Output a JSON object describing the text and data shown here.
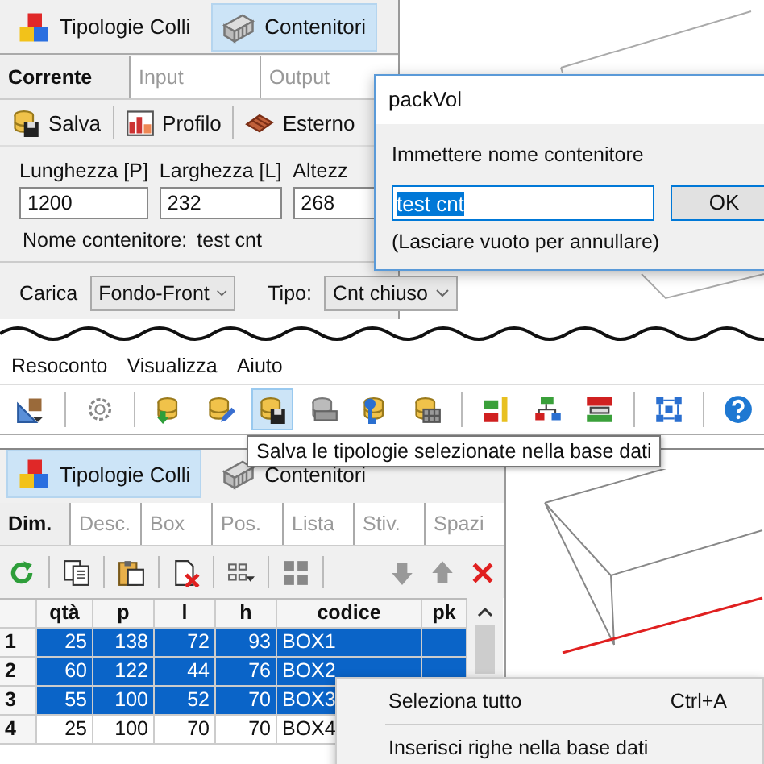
{
  "top_panel": {
    "tabs": [
      {
        "label": "Tipologie Colli",
        "kind": "cubes",
        "selected": false
      },
      {
        "label": "Contenitori",
        "kind": "container",
        "selected": true
      }
    ],
    "sub_tabs": [
      {
        "label": "Corrente",
        "selected": true
      },
      {
        "label": "Input",
        "selected": false
      },
      {
        "label": "Output",
        "selected": false
      }
    ],
    "toolbar": [
      {
        "label": "Salva",
        "kind": "db-save"
      },
      {
        "label": "Profilo",
        "kind": "chart"
      },
      {
        "label": "Esterno",
        "kind": "pallet"
      }
    ],
    "fields": [
      {
        "label": "Lunghezza [P]",
        "value": "1200"
      },
      {
        "label": "Larghezza [L]",
        "value": "232"
      },
      {
        "label": "Altezz",
        "value": "268"
      }
    ],
    "name_label": "Nome contenitore:",
    "name_value": "test cnt",
    "load_label": "Carica",
    "load_value": "Fondo-Front",
    "type_label": "Tipo:",
    "type_value": "Cnt chiuso"
  },
  "dialog": {
    "title": "packVol",
    "prompt": "Immettere nome contenitore",
    "value": "test cnt",
    "value_selected": true,
    "ok": "OK",
    "hint": "(Lasciare vuoto per annullare)"
  },
  "menu": [
    "Resoconto",
    "Visualizza",
    "Aiuto"
  ],
  "toolbar": [
    [
      {
        "kind": "measure",
        "hovered": false
      }
    ],
    [
      {
        "kind": "gear",
        "hovered": false
      }
    ],
    [
      {
        "kind": "db-down",
        "hovered": false
      },
      {
        "kind": "db-edit",
        "hovered": false
      },
      {
        "kind": "db-save",
        "hovered": true
      },
      {
        "kind": "db-block",
        "hovered": false
      },
      {
        "kind": "db-key",
        "hovered": false
      },
      {
        "kind": "db-grid",
        "hovered": false
      }
    ],
    [
      {
        "kind": "bars-a",
        "hovered": false
      },
      {
        "kind": "tree",
        "hovered": false
      },
      {
        "kind": "bars-b",
        "hovered": false
      }
    ],
    [
      {
        "kind": "network",
        "hovered": false
      }
    ],
    [
      {
        "kind": "help",
        "hovered": false
      }
    ]
  ],
  "tooltip": "Salva le tipologie selezionate nella base dati",
  "bottom_panel": {
    "tabs": [
      {
        "label": "Tipologie Colli",
        "kind": "cubes",
        "selected": true
      },
      {
        "label": "Contenitori",
        "kind": "container",
        "selected": false
      }
    ],
    "sub_tabs": [
      {
        "label": "Dim.",
        "selected": true
      },
      {
        "label": "Desc.",
        "selected": false
      },
      {
        "label": "Box",
        "selected": false
      },
      {
        "label": "Pos.",
        "selected": false
      },
      {
        "label": "Lista",
        "selected": false
      },
      {
        "label": "Stiv.",
        "selected": false
      },
      {
        "label": "Spazi",
        "selected": false
      }
    ],
    "toolbar": [
      [
        {
          "kind": "refresh"
        }
      ],
      [
        {
          "kind": "copy"
        }
      ],
      [
        {
          "kind": "paste"
        }
      ],
      [
        {
          "kind": "delete"
        }
      ],
      [
        {
          "kind": "grid-menu"
        }
      ],
      [
        {
          "kind": "grid"
        }
      ],
      [
        {
          "kind": "down"
        },
        {
          "kind": "up"
        },
        {
          "kind": "close"
        }
      ]
    ],
    "table": {
      "columns": [
        "qtà",
        "p",
        "l",
        "h",
        "codice",
        "pk"
      ],
      "rows": [
        {
          "number": "1",
          "cells": [
            "25",
            "138",
            "72",
            "93",
            "BOX1"
          ],
          "selected": true
        },
        {
          "number": "2",
          "cells": [
            "60",
            "122",
            "44",
            "76",
            "BOX2"
          ],
          "selected": true
        },
        {
          "number": "3",
          "cells": [
            "55",
            "100",
            "52",
            "70",
            "BOX3"
          ],
          "selected": true
        },
        {
          "number": "4",
          "cells": [
            "25",
            "100",
            "70",
            "70",
            "BOX4"
          ],
          "selected": false
        }
      ]
    }
  },
  "context_menu": [
    {
      "label": "Seleziona tutto",
      "shortcut": "Ctrl+A"
    },
    {
      "label": "Inserisci righe nella base dati"
    }
  ]
}
